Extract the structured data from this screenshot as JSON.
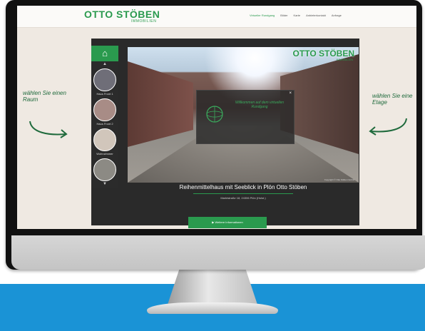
{
  "site": {
    "logo": "OTTO STÖBEN",
    "logo_sub": "IMMOBILIEN",
    "nav": [
      "Virtueller Rundgang",
      "Bilder",
      "Karte",
      "Anbieterkontakt",
      "Anfrage"
    ]
  },
  "viewer": {
    "pano_logo": "OTTO STÖBEN",
    "pano_logo_sub": "IMMOBILIEN",
    "copyright": "Copyright © Otto Stöben GmbH",
    "popup_text": "Willkommen auf dem virtuellen Rundgang",
    "rooms": [
      {
        "label": "Haus Front 1",
        "color": "#6f6e78"
      },
      {
        "label": "Haus Front 2",
        "color": "#a88c86"
      },
      {
        "label": "Wohnzimmer",
        "color": "#d1c6bb"
      },
      {
        "label": "",
        "color": "#8c8a84"
      }
    ]
  },
  "caption": {
    "title": "Reihenmittelhaus mit Seeblick in Plön Otto Stöben",
    "subtitle": "Marktstraße 18, 24306 Plön (Holst.)"
  },
  "cta": {
    "label": "Weitere Informationen"
  },
  "hints": {
    "left": "wählen Sie einen Raum",
    "right": "wählen Sie eine Etage"
  }
}
